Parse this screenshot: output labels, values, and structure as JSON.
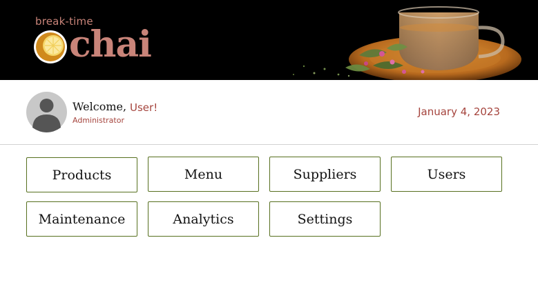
{
  "header": {
    "logo_small": "break-time",
    "logo_big": "chai"
  },
  "user": {
    "welcome": "Welcome,",
    "name": "User!",
    "role": "Administrator"
  },
  "date": "January 4, 2023",
  "nav": {
    "row1": [
      "Products",
      "Menu",
      "Suppliers",
      "Users"
    ],
    "row2": [
      "Maintenance",
      "Analytics",
      "Settings"
    ]
  },
  "colors": {
    "brand": "#c98479",
    "accent": "#a5443d",
    "button_border": "#566f1e"
  }
}
